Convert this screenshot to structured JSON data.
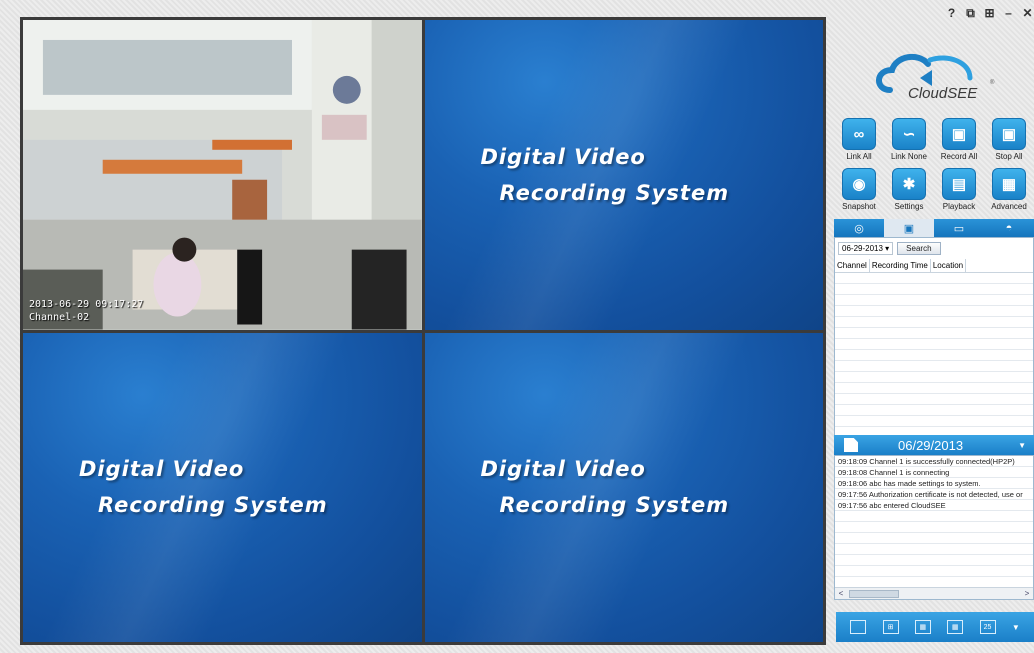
{
  "window": {
    "controls": [
      "?",
      "⧉",
      "⊞",
      "–",
      "✕"
    ]
  },
  "logo": {
    "text": "CloudSEE",
    "mark": "®"
  },
  "video": {
    "camera": {
      "timestamp": "2013-06-29 09:17:27",
      "channel": "Channel-02"
    },
    "placeholder": {
      "line1": "Digital Video",
      "line2": "Recording System"
    }
  },
  "toolbar": {
    "row1": [
      {
        "label": "Link All",
        "icon": "link-all-icon",
        "glyph": "∞"
      },
      {
        "label": "Link None",
        "icon": "link-none-icon",
        "glyph": "∽"
      },
      {
        "label": "Record All",
        "icon": "record-all-icon",
        "glyph": "▣"
      },
      {
        "label": "Stop All",
        "icon": "stop-all-icon",
        "glyph": "▣"
      }
    ],
    "row2": [
      {
        "label": "Snapshot",
        "icon": "snapshot-icon",
        "glyph": "◉"
      },
      {
        "label": "Settings",
        "icon": "gear-icon",
        "glyph": "✱"
      },
      {
        "label": "Playback",
        "icon": "playback-icon",
        "glyph": "▤"
      },
      {
        "label": "Advanced",
        "icon": "advanced-icon",
        "glyph": "▦"
      }
    ]
  },
  "tabs": [
    {
      "icon": "ptz-icon",
      "glyph": "◎"
    },
    {
      "icon": "record-search-icon",
      "glyph": "▣"
    },
    {
      "icon": "device-icon",
      "glyph": "▭"
    },
    {
      "icon": "color-icon",
      "glyph": "◓"
    }
  ],
  "records": {
    "date": "06-29-2013",
    "dropdown_glyph": "▾",
    "search_label": "Search",
    "columns": [
      "Channel",
      "Recording Time",
      "Location"
    ]
  },
  "log": {
    "date": "06/29/2013",
    "entries": [
      "09:18:09 Channel 1 is successfully connected(HP2P)",
      "09:18:08 Channel 1 is connecting",
      "09:18:06 abc has made settings to system.",
      "09:17:56 Authorization certificate is not detected, use or",
      "09:17:56 abc entered CloudSEE"
    ],
    "scroll_left": "<",
    "scroll_right": ">"
  },
  "layouts": [
    {
      "icon": "layout-1-icon",
      "label": ""
    },
    {
      "icon": "layout-4-icon",
      "label": "⊞"
    },
    {
      "icon": "layout-9-icon",
      "label": "▦"
    },
    {
      "icon": "layout-16-icon",
      "label": "▦"
    },
    {
      "icon": "layout-25-icon",
      "label": "25"
    }
  ]
}
